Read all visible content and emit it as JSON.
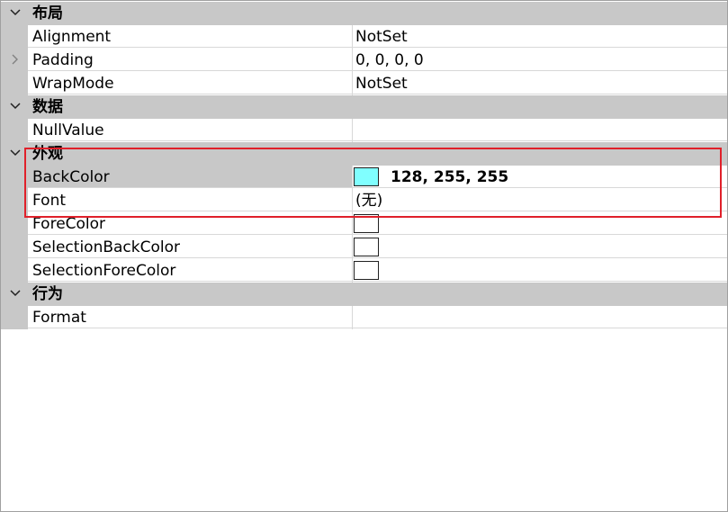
{
  "categories": [
    {
      "label": "布局",
      "properties": [
        {
          "name": "Alignment",
          "value": "NotSet"
        },
        {
          "name": "Padding",
          "value": "0, 0, 0, 0",
          "expandable": true
        },
        {
          "name": "WrapMode",
          "value": "NotSet"
        }
      ]
    },
    {
      "label": "数据",
      "properties": [
        {
          "name": "NullValue",
          "value": ""
        }
      ]
    },
    {
      "label": "外观",
      "properties": [
        {
          "name": "BackColor",
          "value": "128, 255, 255",
          "swatch": "#80ffff",
          "bold": true
        },
        {
          "name": "Font",
          "value": "(无)"
        },
        {
          "name": "ForeColor",
          "value": "",
          "swatch": "#ffffff"
        },
        {
          "name": "SelectionBackColor",
          "value": "",
          "swatch": "#ffffff"
        },
        {
          "name": "SelectionForeColor",
          "value": "",
          "swatch": "#ffffff"
        }
      ]
    },
    {
      "label": "行为",
      "properties": [
        {
          "name": "Format",
          "value": ""
        }
      ]
    }
  ],
  "colors": {
    "category_bg": "#c8c8c8",
    "highlight": "#e0202a"
  }
}
